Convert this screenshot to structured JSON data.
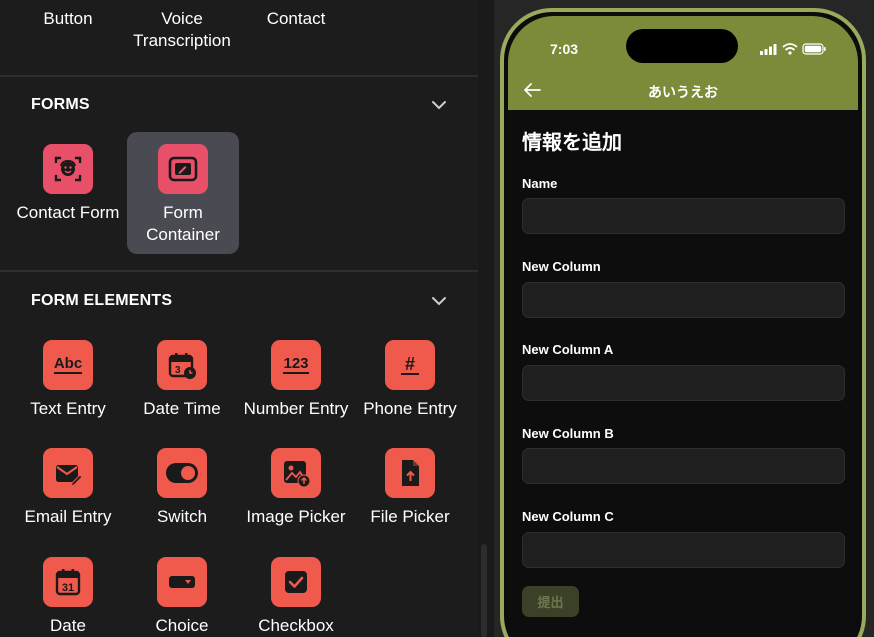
{
  "top_row": [
    {
      "label": "Button"
    },
    {
      "label": "Voice\nTranscription"
    },
    {
      "label": "Contact"
    }
  ],
  "forms_section": {
    "title": "FORMS",
    "items": [
      {
        "label": "Contact Form",
        "icon": "contact-face-icon"
      },
      {
        "label": "Form\nContainer",
        "icon": "edit-frame-icon",
        "selected": true
      }
    ]
  },
  "form_elements_section": {
    "title": "FORM ELEMENTS",
    "items": [
      {
        "label": "Text Entry",
        "icon_text": "Abc"
      },
      {
        "label": "Date Time",
        "icon": "calendar-clock-icon"
      },
      {
        "label": "Number Entry",
        "icon_text": "123"
      },
      {
        "label": "Phone Entry",
        "icon_text": "#"
      },
      {
        "label": "Email Entry",
        "icon": "email-edit-icon"
      },
      {
        "label": "Switch",
        "icon": "toggle-icon"
      },
      {
        "label": "Image Picker",
        "icon": "image-upload-icon"
      },
      {
        "label": "File Picker",
        "icon": "file-upload-icon"
      },
      {
        "label": "Date",
        "icon_text": "31"
      },
      {
        "label": "Choice",
        "icon": "dropdown-icon"
      },
      {
        "label": "Checkbox",
        "icon": "checkbox-icon"
      }
    ]
  },
  "phone": {
    "time": "7:03",
    "nav_title": "あいうえお",
    "form_title": "情報を追加",
    "fields": [
      {
        "label": "Name",
        "value": ""
      },
      {
        "label": "New Column",
        "value": ""
      },
      {
        "label": "New Column A",
        "value": ""
      },
      {
        "label": "New Column B",
        "value": ""
      },
      {
        "label": "New Column C",
        "value": ""
      }
    ],
    "submit_label": "提出"
  },
  "colors": {
    "accent_pink": "#e8506a",
    "accent_coral": "#ef5a4d",
    "appbar_olive": "#7b8b3a",
    "phone_frame": "#9aaa5c",
    "selected_tile": "#4a4a52"
  }
}
